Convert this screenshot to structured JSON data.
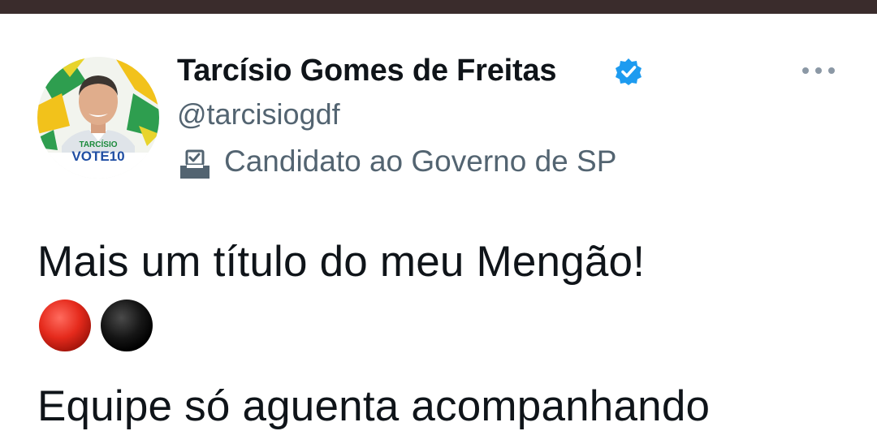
{
  "profile": {
    "name": "Tarcísio Gomes de Freitas",
    "handle": "@tarcisiogdf",
    "bio": "Candidato ao Governo de SP",
    "verified": true,
    "avatar_badge_line1": "TARCÍSIO",
    "avatar_badge_line2": "VOTE10"
  },
  "tweet": {
    "line1": "Mais um título do meu Mengão!",
    "emojis": [
      "red-circle",
      "black-circle"
    ],
    "line2": "Equipe só aguenta acompanhando"
  },
  "colors": {
    "verified": "#1d9bf0",
    "secondary_text": "#536471",
    "top_bar": "#3a2c2c",
    "badge_green": "#1a8a3a"
  },
  "icons": {
    "verified": "verified-badge-icon",
    "ballot": "ballot-box-icon",
    "more": "more-options-icon"
  }
}
